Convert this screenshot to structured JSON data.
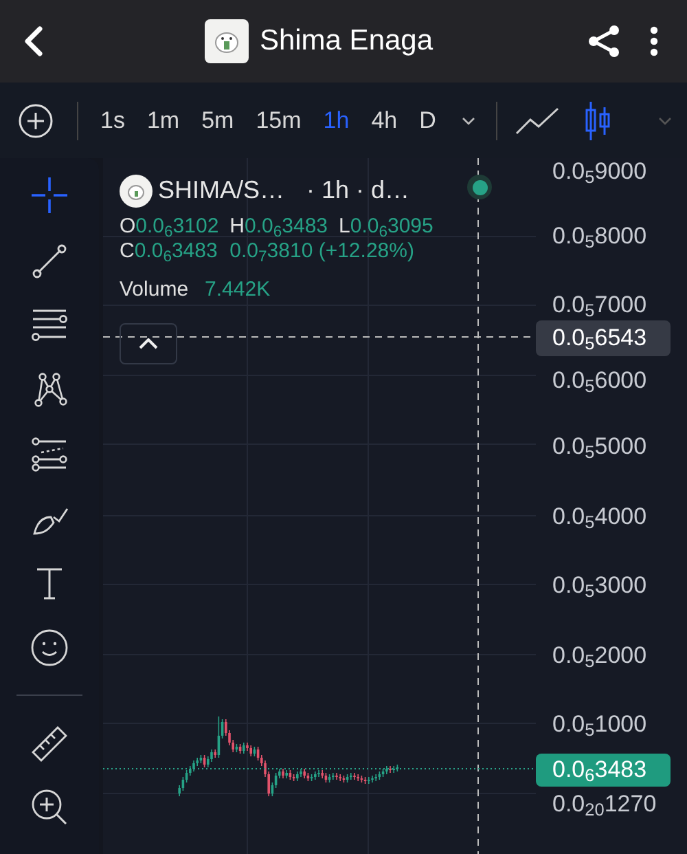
{
  "header": {
    "title": "Shima Enaga"
  },
  "toolbar": {
    "timeframes": [
      {
        "label": "1s",
        "selected": false
      },
      {
        "label": "1m",
        "selected": false
      },
      {
        "label": "5m",
        "selected": false
      },
      {
        "label": "15m",
        "selected": false
      },
      {
        "label": "1h",
        "selected": true
      },
      {
        "label": "4h",
        "selected": false
      },
      {
        "label": "D",
        "selected": false
      }
    ],
    "chart_types": [
      {
        "kind": "line",
        "selected": false
      },
      {
        "kind": "candles",
        "selected": true
      }
    ]
  },
  "tools": [
    {
      "kind": "crosshair",
      "selected": true
    },
    {
      "kind": "trend-line",
      "selected": false
    },
    {
      "kind": "lines",
      "selected": false
    },
    {
      "kind": "pattern",
      "selected": false
    },
    {
      "kind": "fib",
      "selected": false
    },
    {
      "kind": "brush",
      "selected": false
    },
    {
      "kind": "text",
      "selected": false
    },
    {
      "kind": "emoji",
      "selected": false
    },
    {
      "kind": "divider"
    },
    {
      "kind": "ruler",
      "selected": false
    },
    {
      "kind": "zoom",
      "selected": false
    }
  ],
  "legend": {
    "symbol": "SHIMA/S…",
    "interval": "· 1h · d…",
    "live": true,
    "ohlc": [
      {
        "label": "O",
        "value": "0.0$_{6}$3102"
      },
      {
        "label": "H",
        "value": "0.0$_{6}$3483"
      },
      {
        "label": "L",
        "value": "0.0$_{6}$3095"
      },
      {
        "label": "C",
        "value": "0.0$_{6}$3483"
      }
    ],
    "change": "0.0$_{7}$3810 (+12.28%)",
    "volume_label": "Volume",
    "volume": "7.442K"
  },
  "price_axis": [
    "0.0$_{5}$9000",
    "0.0$_{5}$8000",
    "0.0$_{5}$7000",
    "0.0$_{5}$6000",
    "0.0$_{5}$5000",
    "0.0$_{5}$4000",
    "0.0$_{5}$3000",
    "0.0$_{5}$2000",
    "0.0$_{5}$1000",
    "0.0$_{20}$1270"
  ],
  "crosshair_price": "0.0$_{5}$6543",
  "last_price": "0.0$_{6}$3483"
}
